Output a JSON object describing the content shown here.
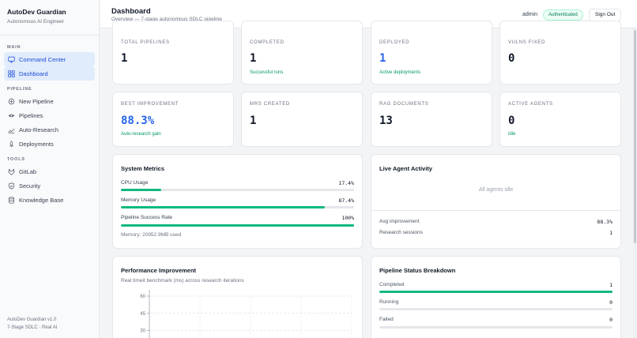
{
  "sidebar": {
    "title": "AutoDev Guardian",
    "subtitle": "Autonomous AI Engineer",
    "sections": {
      "main": "MAIN",
      "pipeline": "PIPELINE",
      "tools": "TOOLS"
    },
    "items": {
      "command_center": "Command Center",
      "dashboard": "Dashboard",
      "new_pipeline": "New Pipeline",
      "pipelines": "Pipelines",
      "auto_research": "Auto-Research",
      "deployments": "Deployments",
      "gitlab": "GitLab",
      "security": "Security",
      "knowledge_base": "Knowledge Base"
    },
    "footer_version": "AutoDev Guardian v1.0",
    "footer_tagline": "7-Stage SDLC · Real AI"
  },
  "header": {
    "title": "Dashboard",
    "subtitle": "Overview — 7-stage autonomous SDLC pipeline",
    "user": "admin",
    "status_badge": "Authenticated",
    "signout_label": "Sign Out"
  },
  "stats": {
    "total_pipelines": {
      "label": "TOTAL PIPELINES",
      "value": "1"
    },
    "completed": {
      "label": "COMPLETED",
      "value": "1",
      "sub": "Successful runs"
    },
    "deployed": {
      "label": "DEPLOYED",
      "value": "1",
      "sub": "Active deployments"
    },
    "vulns_fixed": {
      "label": "VULNS FIXED",
      "value": "0"
    },
    "best_improvement": {
      "label": "BEST IMPROVEMENT",
      "value": "88.3%",
      "sub": "Auto-research gain"
    },
    "mrs_created": {
      "label": "MRS CREATED",
      "value": "1"
    },
    "rag_documents": {
      "label": "RAG DOCUMENTS",
      "value": "13"
    },
    "active_agents": {
      "label": "ACTIVE AGENTS",
      "value": "0",
      "sub": "idle"
    }
  },
  "system_metrics": {
    "title": "System Metrics",
    "cpu": {
      "label": "CPU Usage",
      "display": "17.4%",
      "percent": 17.4
    },
    "memory": {
      "label": "Memory Usage",
      "display": "87.4%",
      "percent": 87.4
    },
    "pipeline_success": {
      "label": "Pipeline Success Rate",
      "display": "100%",
      "percent": 100
    },
    "memory_used": "Memory: 20952.9MB used"
  },
  "live_activity": {
    "title": "Live Agent Activity",
    "empty_text": "All agents idle",
    "avg_improvement_label": "Avg improvement",
    "avg_improvement_value": "88.3%",
    "research_sessions_label": "Research sessions",
    "research_sessions_value": "1"
  },
  "performance": {
    "title": "Performance Improvement",
    "subtitle": "Real timeit benchmark (ms) across research iterations"
  },
  "chart_data": {
    "type": "line",
    "title": "Performance Improvement",
    "subtitle": "Real timeit benchmark (ms) across research iterations",
    "xlabel": "",
    "ylabel": "",
    "ylim": [
      0,
      60
    ],
    "y_ticks": [
      "60",
      "45",
      "30"
    ],
    "grid": true,
    "series": []
  },
  "pipeline_status": {
    "title": "Pipeline Status Breakdown",
    "completed": {
      "label": "Completed",
      "value": "1",
      "fraction": 1
    },
    "running": {
      "label": "Running",
      "value": "0",
      "fraction": 0
    },
    "failed": {
      "label": "Failed",
      "value": "0",
      "fraction": 0
    }
  },
  "colors": {
    "accent": "#2563eb",
    "success": "#10b981",
    "active_nav_bg": "#e0ebfb"
  }
}
